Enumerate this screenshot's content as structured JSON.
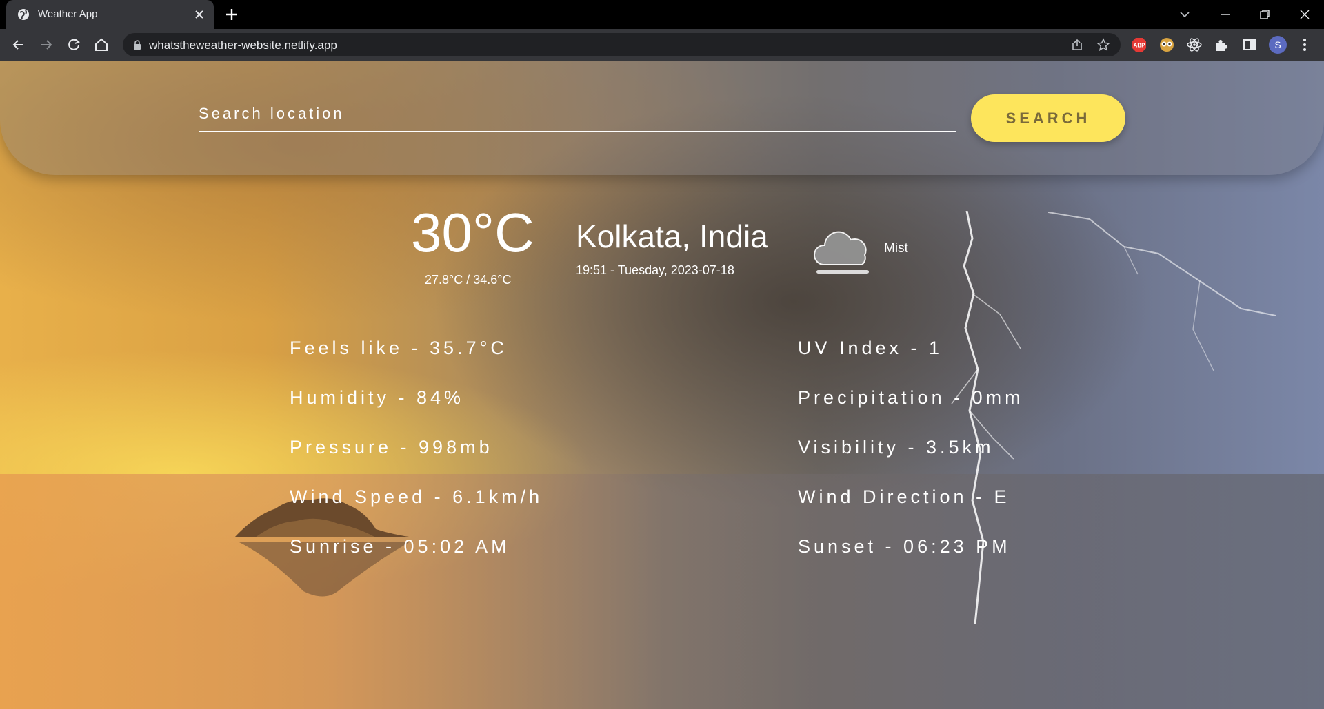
{
  "browser": {
    "tab_title": "Weather App",
    "url": "whatstheweather-website.netlify.app",
    "profile_initial": "S",
    "extensions": [
      "adblock-plus-icon",
      "owl-extension-icon",
      "react-devtools-icon",
      "puzzle-extensions-icon",
      "side-panel-icon"
    ]
  },
  "search": {
    "placeholder": "Search location",
    "button_label": "SEARCH",
    "button_color": "#fde55c"
  },
  "current": {
    "temperature": "30°C",
    "range": "27.8°C / 34.6°C",
    "location": "Kolkata, India",
    "datetime": "19:51 - Tuesday, 2023-07-18",
    "condition": "Mist",
    "condition_icon": "mist-cloud-icon"
  },
  "details": {
    "feels_like": "Feels like - 35.7°C",
    "humidity": "Humidity - 84%",
    "pressure": "Pressure - 998mb",
    "wind_speed": "Wind Speed - 6.1km/h",
    "sunrise": "Sunrise - 05:02 AM",
    "uv_index": "UV Index - 1",
    "precipitation": "Precipitation - 0mm",
    "visibility": "Visibility - 3.5km",
    "wind_direction": "Wind Direction - E",
    "sunset": "Sunset - 06:23 PM"
  }
}
